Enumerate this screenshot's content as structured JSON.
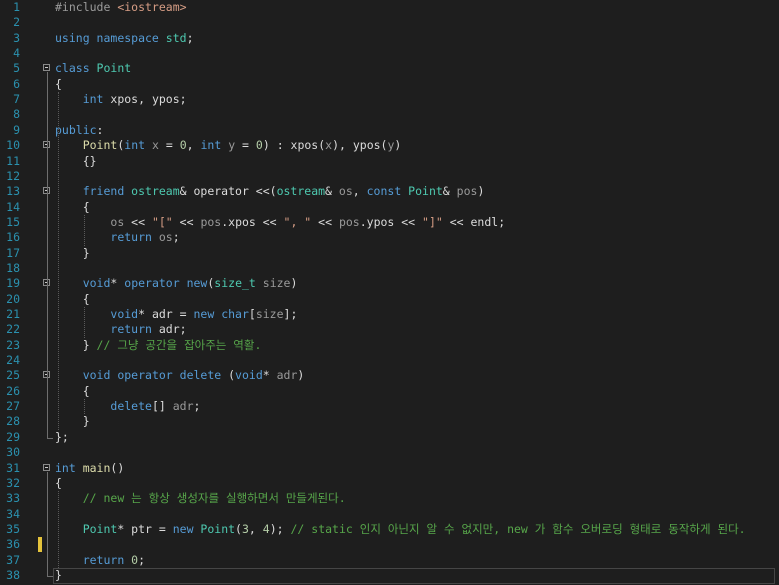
{
  "editor": {
    "language": "C++",
    "colors": {
      "background": "#1e1e1e",
      "line_number": "#2b91af",
      "keyword": "#569cd6",
      "type": "#4ec9b0",
      "function": "#dcdcaa",
      "comment": "#57a64a",
      "string": "#d69d85",
      "number": "#b5cea8",
      "text": "#dcdcdc",
      "change_marker": "#e5c33b"
    },
    "lines": [
      {
        "n": "1",
        "tokens": [
          {
            "t": "#include ",
            "c": "pp"
          },
          {
            "t": "<iostream>",
            "c": "st"
          }
        ]
      },
      {
        "n": "2",
        "tokens": []
      },
      {
        "n": "3",
        "tokens": [
          {
            "t": "using ",
            "c": "kw"
          },
          {
            "t": "namespace ",
            "c": "kw"
          },
          {
            "t": "std",
            "c": "ty"
          },
          {
            "t": ";",
            "c": "vr"
          }
        ]
      },
      {
        "n": "4",
        "tokens": []
      },
      {
        "n": "5",
        "tokens": [
          {
            "t": "class ",
            "c": "kw"
          },
          {
            "t": "Point",
            "c": "ty"
          }
        ]
      },
      {
        "n": "6",
        "tokens": [
          {
            "t": "{",
            "c": "vr"
          }
        ]
      },
      {
        "n": "7",
        "tokens": [
          {
            "t": "    ",
            "c": "vr"
          },
          {
            "t": "int ",
            "c": "kw"
          },
          {
            "t": "xpos, ypos;",
            "c": "vr"
          }
        ]
      },
      {
        "n": "8",
        "tokens": []
      },
      {
        "n": "9",
        "tokens": [
          {
            "t": "public",
            "c": "kw"
          },
          {
            "t": ":",
            "c": "vr"
          }
        ]
      },
      {
        "n": "10",
        "tokens": [
          {
            "t": "    ",
            "c": "vr"
          },
          {
            "t": "Point",
            "c": "fn"
          },
          {
            "t": "(",
            "c": "vr"
          },
          {
            "t": "int ",
            "c": "kw"
          },
          {
            "t": "x",
            "c": "pa"
          },
          {
            "t": " = ",
            "c": "vr"
          },
          {
            "t": "0",
            "c": "nm"
          },
          {
            "t": ", ",
            "c": "vr"
          },
          {
            "t": "int ",
            "c": "kw"
          },
          {
            "t": "y",
            "c": "pa"
          },
          {
            "t": " = ",
            "c": "vr"
          },
          {
            "t": "0",
            "c": "nm"
          },
          {
            "t": ") : xpos(",
            "c": "vr"
          },
          {
            "t": "x",
            "c": "pa"
          },
          {
            "t": "), ypos(",
            "c": "vr"
          },
          {
            "t": "y",
            "c": "pa"
          },
          {
            "t": ")",
            "c": "vr"
          }
        ]
      },
      {
        "n": "11",
        "tokens": [
          {
            "t": "    {}",
            "c": "vr"
          }
        ]
      },
      {
        "n": "12",
        "tokens": []
      },
      {
        "n": "13",
        "tokens": [
          {
            "t": "    ",
            "c": "vr"
          },
          {
            "t": "friend ",
            "c": "kw"
          },
          {
            "t": "ostream",
            "c": "ty"
          },
          {
            "t": "& operator <<(",
            "c": "vr"
          },
          {
            "t": "ostream",
            "c": "ty"
          },
          {
            "t": "& ",
            "c": "vr"
          },
          {
            "t": "os",
            "c": "pa"
          },
          {
            "t": ", ",
            "c": "vr"
          },
          {
            "t": "const ",
            "c": "kw"
          },
          {
            "t": "Point",
            "c": "ty"
          },
          {
            "t": "& ",
            "c": "vr"
          },
          {
            "t": "pos",
            "c": "pa"
          },
          {
            "t": ")",
            "c": "vr"
          }
        ]
      },
      {
        "n": "14",
        "tokens": [
          {
            "t": "    {",
            "c": "vr"
          }
        ]
      },
      {
        "n": "15",
        "tokens": [
          {
            "t": "        ",
            "c": "vr"
          },
          {
            "t": "os",
            "c": "pa"
          },
          {
            "t": " << ",
            "c": "vr"
          },
          {
            "t": "\"[\"",
            "c": "st"
          },
          {
            "t": " << ",
            "c": "vr"
          },
          {
            "t": "pos",
            "c": "pa"
          },
          {
            "t": ".xpos << ",
            "c": "vr"
          },
          {
            "t": "\", \"",
            "c": "st"
          },
          {
            "t": " << ",
            "c": "vr"
          },
          {
            "t": "pos",
            "c": "pa"
          },
          {
            "t": ".ypos << ",
            "c": "vr"
          },
          {
            "t": "\"]\"",
            "c": "st"
          },
          {
            "t": " << endl;",
            "c": "vr"
          }
        ]
      },
      {
        "n": "16",
        "tokens": [
          {
            "t": "        ",
            "c": "vr"
          },
          {
            "t": "return ",
            "c": "kw"
          },
          {
            "t": "os",
            "c": "pa"
          },
          {
            "t": ";",
            "c": "vr"
          }
        ]
      },
      {
        "n": "17",
        "tokens": [
          {
            "t": "    }",
            "c": "vr"
          }
        ]
      },
      {
        "n": "18",
        "tokens": []
      },
      {
        "n": "19",
        "tokens": [
          {
            "t": "    ",
            "c": "vr"
          },
          {
            "t": "void",
            "c": "kw"
          },
          {
            "t": "* ",
            "c": "vr"
          },
          {
            "t": "operator ",
            "c": "kw"
          },
          {
            "t": "new",
            "c": "kw"
          },
          {
            "t": "(",
            "c": "vr"
          },
          {
            "t": "size_t ",
            "c": "ty"
          },
          {
            "t": "size",
            "c": "pa"
          },
          {
            "t": ")",
            "c": "vr"
          }
        ]
      },
      {
        "n": "20",
        "tokens": [
          {
            "t": "    {",
            "c": "vr"
          }
        ]
      },
      {
        "n": "21",
        "tokens": [
          {
            "t": "        ",
            "c": "vr"
          },
          {
            "t": "void",
            "c": "kw"
          },
          {
            "t": "* adr = ",
            "c": "vr"
          },
          {
            "t": "new ",
            "c": "kw"
          },
          {
            "t": "char",
            "c": "kw"
          },
          {
            "t": "[",
            "c": "vr"
          },
          {
            "t": "size",
            "c": "pa"
          },
          {
            "t": "];",
            "c": "vr"
          }
        ]
      },
      {
        "n": "22",
        "tokens": [
          {
            "t": "        ",
            "c": "vr"
          },
          {
            "t": "return ",
            "c": "kw"
          },
          {
            "t": "adr;",
            "c": "vr"
          }
        ]
      },
      {
        "n": "23",
        "tokens": [
          {
            "t": "    } ",
            "c": "vr"
          },
          {
            "t": "// 그냥 공간을 잡아주는 역활.",
            "c": "cm"
          }
        ]
      },
      {
        "n": "24",
        "tokens": []
      },
      {
        "n": "25",
        "tokens": [
          {
            "t": "    ",
            "c": "vr"
          },
          {
            "t": "void ",
            "c": "kw"
          },
          {
            "t": "operator ",
            "c": "kw"
          },
          {
            "t": "delete ",
            "c": "kw"
          },
          {
            "t": "(",
            "c": "vr"
          },
          {
            "t": "void",
            "c": "kw"
          },
          {
            "t": "* ",
            "c": "vr"
          },
          {
            "t": "adr",
            "c": "pa"
          },
          {
            "t": ")",
            "c": "vr"
          }
        ]
      },
      {
        "n": "26",
        "tokens": [
          {
            "t": "    {",
            "c": "vr"
          }
        ]
      },
      {
        "n": "27",
        "tokens": [
          {
            "t": "        ",
            "c": "vr"
          },
          {
            "t": "delete",
            "c": "kw"
          },
          {
            "t": "[] ",
            "c": "vr"
          },
          {
            "t": "adr",
            "c": "pa"
          },
          {
            "t": ";",
            "c": "vr"
          }
        ]
      },
      {
        "n": "28",
        "tokens": [
          {
            "t": "    }",
            "c": "vr"
          }
        ]
      },
      {
        "n": "29",
        "tokens": [
          {
            "t": "};",
            "c": "vr"
          }
        ]
      },
      {
        "n": "30",
        "tokens": []
      },
      {
        "n": "31",
        "tokens": [
          {
            "t": "int ",
            "c": "kw"
          },
          {
            "t": "main",
            "c": "fn"
          },
          {
            "t": "()",
            "c": "vr"
          }
        ]
      },
      {
        "n": "32",
        "tokens": [
          {
            "t": "{",
            "c": "vr"
          }
        ]
      },
      {
        "n": "33",
        "tokens": [
          {
            "t": "    ",
            "c": "vr"
          },
          {
            "t": "// new 는 항상 생성자를 실행하면서 만들게된다.",
            "c": "cm"
          }
        ]
      },
      {
        "n": "34",
        "tokens": []
      },
      {
        "n": "35",
        "tokens": [
          {
            "t": "    ",
            "c": "vr"
          },
          {
            "t": "Point",
            "c": "ty"
          },
          {
            "t": "* ptr = ",
            "c": "vr"
          },
          {
            "t": "new ",
            "c": "kw"
          },
          {
            "t": "Point",
            "c": "ty"
          },
          {
            "t": "(",
            "c": "vr"
          },
          {
            "t": "3",
            "c": "nm"
          },
          {
            "t": ", ",
            "c": "vr"
          },
          {
            "t": "4",
            "c": "nm"
          },
          {
            "t": "); ",
            "c": "vr"
          },
          {
            "t": "// static 인지 아닌지 알 수 없지만, new 가 함수 오버로딩 형태로 동작하게 된다.",
            "c": "cm"
          }
        ]
      },
      {
        "n": "36",
        "tokens": []
      },
      {
        "n": "37",
        "tokens": [
          {
            "t": "    ",
            "c": "vr"
          },
          {
            "t": "return ",
            "c": "kw"
          },
          {
            "t": "0",
            "c": "nm"
          },
          {
            "t": ";",
            "c": "vr"
          }
        ]
      },
      {
        "n": "38",
        "tokens": [
          {
            "t": "}",
            "c": "vr"
          }
        ]
      }
    ]
  }
}
